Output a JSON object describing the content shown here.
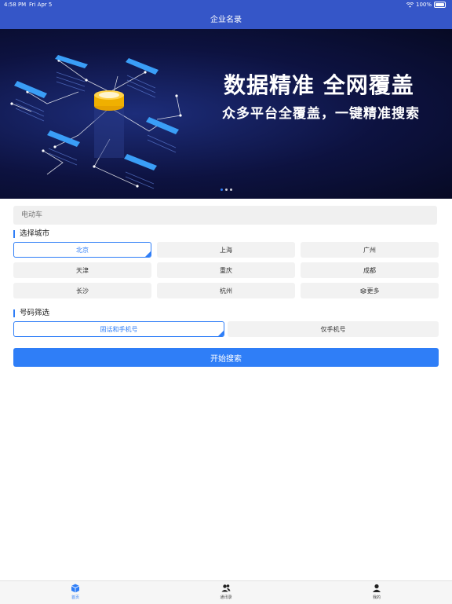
{
  "status_bar": {
    "time": "4:58 PM",
    "date": "Fri Apr 5",
    "battery": "100%"
  },
  "header": {
    "title": "企业名录"
  },
  "banner": {
    "headline": "数据精准 全网覆盖",
    "subline": "众多平台全覆盖，一键精准搜索",
    "slide_count": 3,
    "active_slide": 1
  },
  "search": {
    "placeholder": "电动车"
  },
  "city_section": {
    "label": "选择城市",
    "cities": [
      "北京",
      "上海",
      "广州",
      "天津",
      "重庆",
      "成都",
      "长沙",
      "杭州"
    ],
    "more_label": "更多",
    "selected": "北京"
  },
  "number_section": {
    "label": "号码筛选",
    "options": [
      "固话和手机号",
      "仅手机号"
    ],
    "selected": "固话和手机号"
  },
  "start_button": {
    "label": "开始搜索"
  },
  "tabbar": {
    "items": [
      "首页",
      "通讯录",
      "我的"
    ],
    "active": "首页"
  },
  "colors": {
    "header": "#3556c8",
    "accent": "#2f7ef7"
  }
}
